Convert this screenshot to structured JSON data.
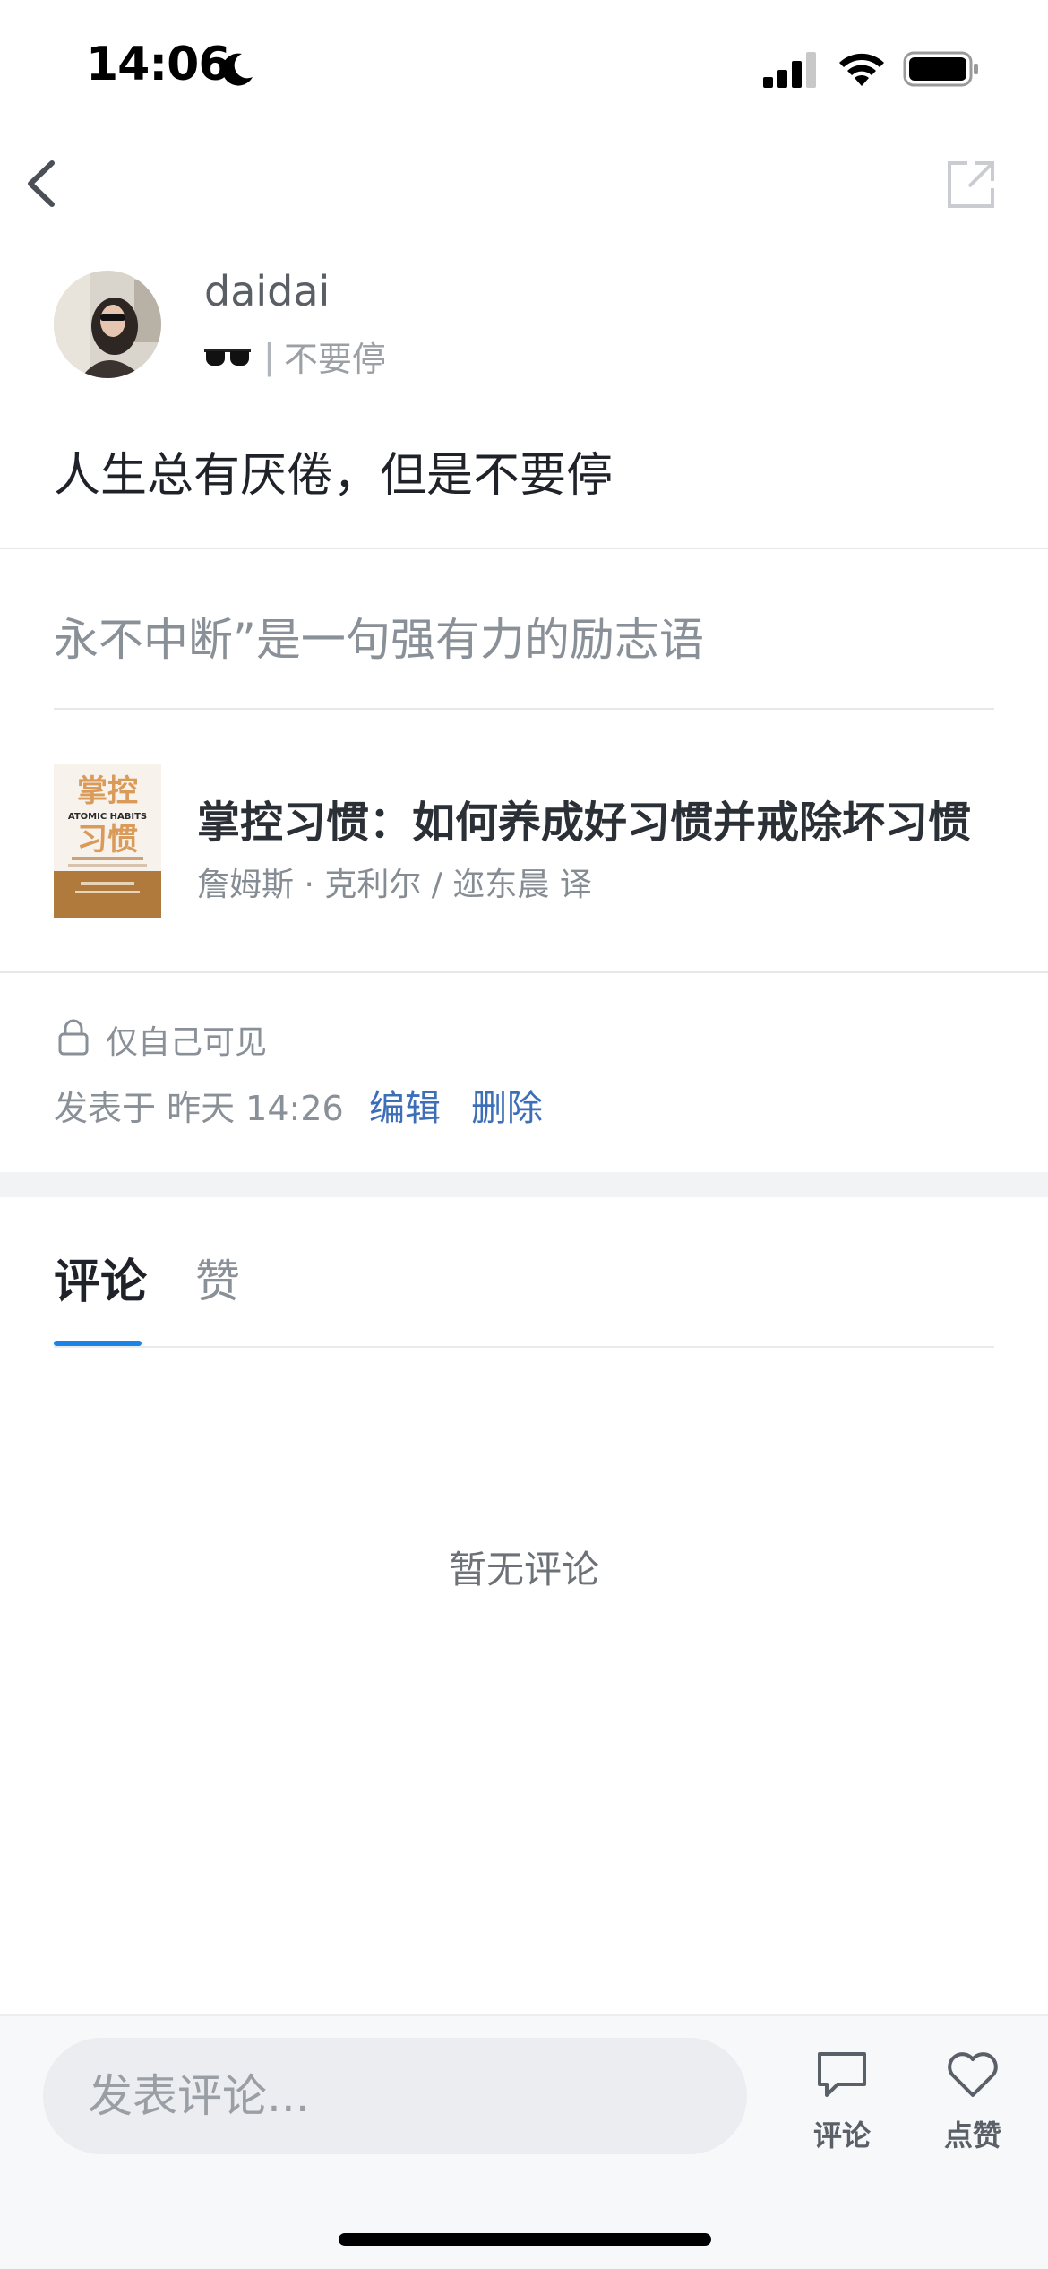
{
  "status_bar": {
    "time": "14:06",
    "icons": [
      "moon-icon",
      "cellular-signal-icon",
      "wifi-icon",
      "battery-icon"
    ]
  },
  "nav": {
    "back_icon": "chevron-left-icon",
    "share_icon": "share-external-icon"
  },
  "author": {
    "name": "daidai",
    "bio_emoji": "sunglasses-icon",
    "bio_separator": "|",
    "bio": "不要停"
  },
  "post": {
    "title": "人生总有厌倦，但是不要停",
    "excerpt": "永不中断”是一句强有力的励志语"
  },
  "book": {
    "title": "掌控习惯：如何养成好习惯并戒除坏习惯",
    "author": "詹姆斯 · 克利尔 / 迩东晨 译",
    "cover": {
      "title_top": "掌控",
      "title_bottom": "习惯",
      "english": "ATOMIC HABITS"
    }
  },
  "meta": {
    "visibility": "仅自己可见",
    "posted_at": "发表于 昨天 14:26",
    "edit": "编辑",
    "delete": "删除"
  },
  "tabs": {
    "comments": "评论",
    "likes": "赞",
    "active": "comments"
  },
  "comments": {
    "empty": "暂无评论"
  },
  "bottom_bar": {
    "input_placeholder": "发表评论...",
    "comment_label": "评论",
    "like_label": "点赞"
  },
  "colors": {
    "accent": "#1a84e8",
    "link": "#3d6fb8",
    "text_primary": "#1f2329",
    "text_secondary": "#8a9097"
  }
}
